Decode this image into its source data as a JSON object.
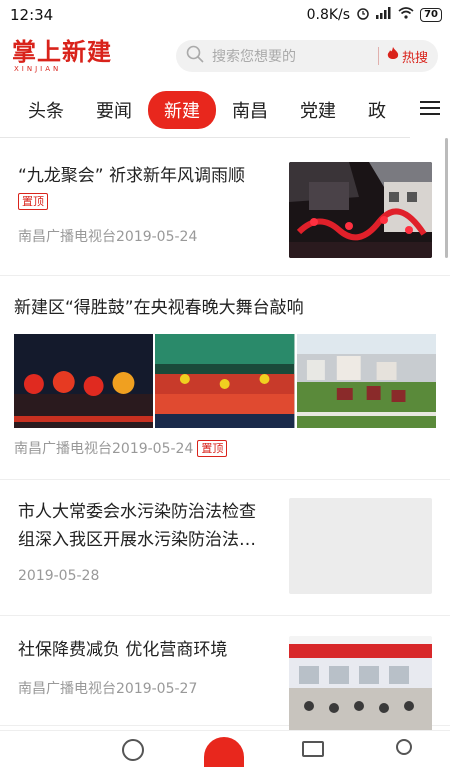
{
  "status": {
    "time": "12:34",
    "speed": "0.8K/s",
    "battery": "70"
  },
  "header": {
    "logo": "掌上新建",
    "logo_sub": "XINJIAN",
    "search_placeholder": "搜索您想要的",
    "hot": "热搜"
  },
  "nav": {
    "tabs": [
      "头条",
      "要闻",
      "新建",
      "南昌",
      "党建",
      "政"
    ],
    "active_index": 2
  },
  "feed": {
    "item1": {
      "title": "“九龙聚会” 祈求新年风调雨顺",
      "badge": "置顶",
      "meta": "南昌广播电视台2019-05-24"
    },
    "item2": {
      "title": "新建区“得胜鼓”在央视春晚大舞台敲响",
      "meta": "南昌广播电视台2019-05-24",
      "badge": "置顶"
    },
    "item3": {
      "title_line1": "市人大常委会水污染防治法检查",
      "title_line2": "组深入我区开展水污染防治法…",
      "meta": "2019-05-28"
    },
    "item4": {
      "title": "社保降费减负 优化营商环境",
      "meta": "南昌广播电视台2019-05-27"
    }
  },
  "colors": {
    "accent": "#d9231b",
    "tab_active": "#e8271d"
  }
}
